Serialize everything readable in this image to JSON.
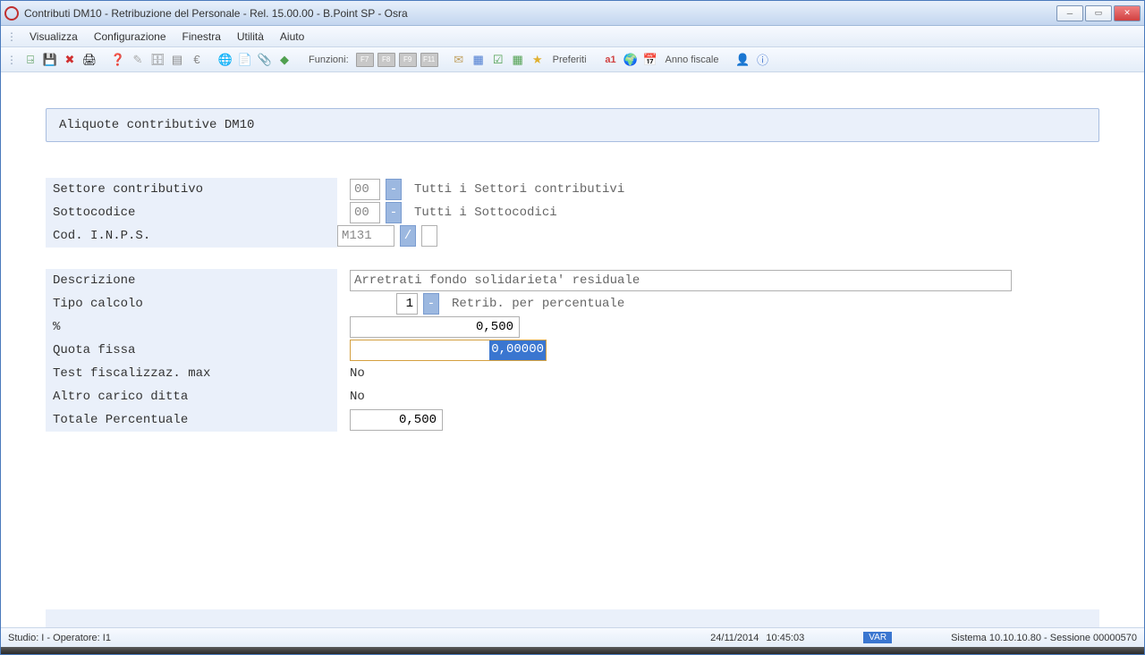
{
  "window": {
    "title": "Contributi DM10 - Retribuzione del Personale - Rel. 15.00.00 - B.Point SP - Osra"
  },
  "menu": {
    "items": [
      "Visualizza",
      "Configurazione",
      "Finestra",
      "Utilità",
      "Aiuto"
    ]
  },
  "toolbar": {
    "funzioni_label": "Funzioni:",
    "fkeys": [
      "F7",
      "F8",
      "F9",
      "F11"
    ],
    "preferiti": "Preferiti",
    "anno_fiscale": "Anno fiscale"
  },
  "page": {
    "header": "Aliquote contributive DM10"
  },
  "form": {
    "settore_label": "Settore contributivo",
    "settore_value": "00",
    "settore_desc": "Tutti i Settori contributivi",
    "sottocodice_label": "Sottocodice",
    "sottocodice_value": "00",
    "sottocodice_desc": "Tutti i Sottocodici",
    "codinps_label": "Cod. I.N.P.S.",
    "codinps_value": "M131",
    "codinps_sep": "/",
    "descrizione_label": "Descrizione",
    "descrizione_value": "Arretrati fondo solidarieta' residuale",
    "tipo_calcolo_label": "Tipo calcolo",
    "tipo_calcolo_value": "1",
    "tipo_calcolo_desc": "Retrib. per percentuale",
    "percent_label": "%",
    "percent_value": "0,500",
    "quota_fissa_label": "Quota fissa",
    "quota_fissa_value": "0,00000",
    "test_fiscal_label": "Test fiscalizzaz. max",
    "test_fiscal_value": "No",
    "altro_carico_label": "Altro carico ditta",
    "altro_carico_value": "No",
    "totale_percent_label": "Totale Percentuale",
    "totale_percent_value": "0,500"
  },
  "status": {
    "left": "Studio: I - Operatore: I1",
    "date": "24/11/2014",
    "time": "10:45:03",
    "badge": "VAR",
    "right": "Sistema 10.10.10.80 - Sessione 00000570"
  }
}
